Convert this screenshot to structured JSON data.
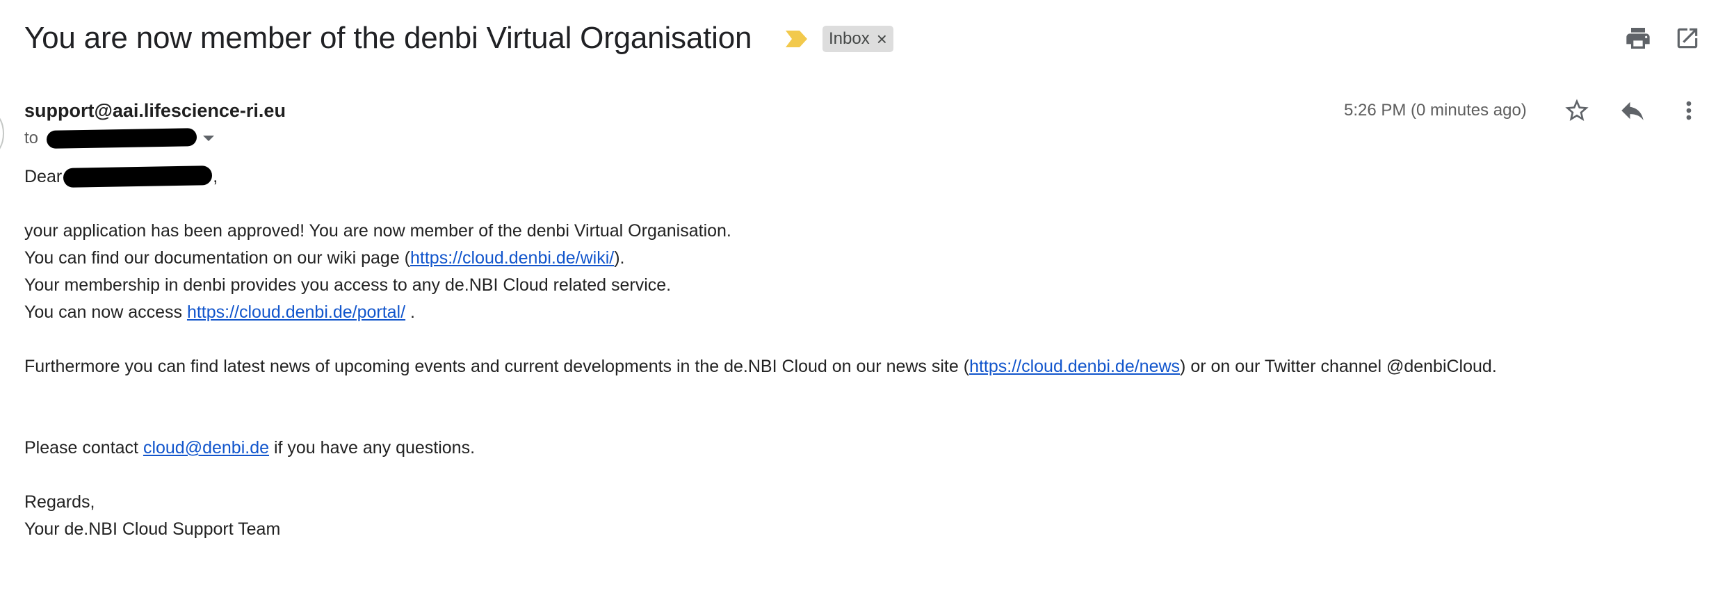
{
  "subject": "You are now member of the denbi Virtual Organisation",
  "label": {
    "name": "Inbox",
    "remove_symbol": "×"
  },
  "toolbar": {
    "print_icon": "print-icon",
    "open_icon": "open-in-new-window-icon"
  },
  "message": {
    "sender": "support@aai.lifescience-ri.eu",
    "to_label": "to",
    "timestamp": "5:26 PM (0 minutes ago)"
  },
  "body": {
    "greeting_prefix": "Dear",
    "greeting_suffix": ",",
    "line1": "your application has been approved! You are now member of the denbi Virtual Organisation.",
    "line2_prefix": "You can find our documentation on our wiki page (",
    "line2_link": "https://cloud.denbi.de/wiki/",
    "line2_suffix": ").",
    "line3": "Your membership in denbi provides you access to any de.NBI Cloud related service.",
    "line4_prefix": "You can now access ",
    "line4_link": "https://cloud.denbi.de/portal/",
    "line4_suffix": " .",
    "line5_prefix": "Furthermore you can find latest news of upcoming events and current developments in the de.NBI Cloud on our news site (",
    "line5_link": "https://cloud.denbi.de/news",
    "line5_suffix": ") or on our Twitter channel @denbiCloud.",
    "line6_prefix": "Please contact ",
    "line6_link": "cloud@denbi.de",
    "line6_suffix": " if you have any questions.",
    "closing": "Regards,",
    "signature": "Your de.NBI Cloud Support Team"
  },
  "colors": {
    "important_marker": "#f2c94c",
    "link": "#1155cc",
    "chip_background": "#dddddd",
    "icon": "#5f6368"
  }
}
